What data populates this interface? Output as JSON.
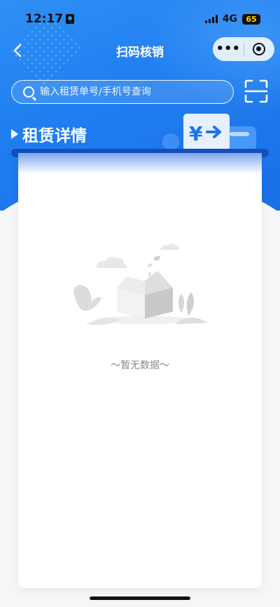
{
  "status_bar": {
    "time": "12:17",
    "network": "4G",
    "battery": "65"
  },
  "nav": {
    "title": "扫码核销",
    "back_icon": "chevron-left-icon",
    "more_label": "•••",
    "close_icon": "target-icon"
  },
  "search": {
    "placeholder": "输入租赁单号/手机号查询",
    "icon": "search-icon"
  },
  "section": {
    "title": "租赁详情",
    "illustration_symbol": "¥"
  },
  "empty_state": {
    "text": "～暂无数据～"
  },
  "colors": {
    "primary": "#1f7ef0",
    "card_edge": "#1450b8",
    "empty_text": "#8a8a8a"
  }
}
